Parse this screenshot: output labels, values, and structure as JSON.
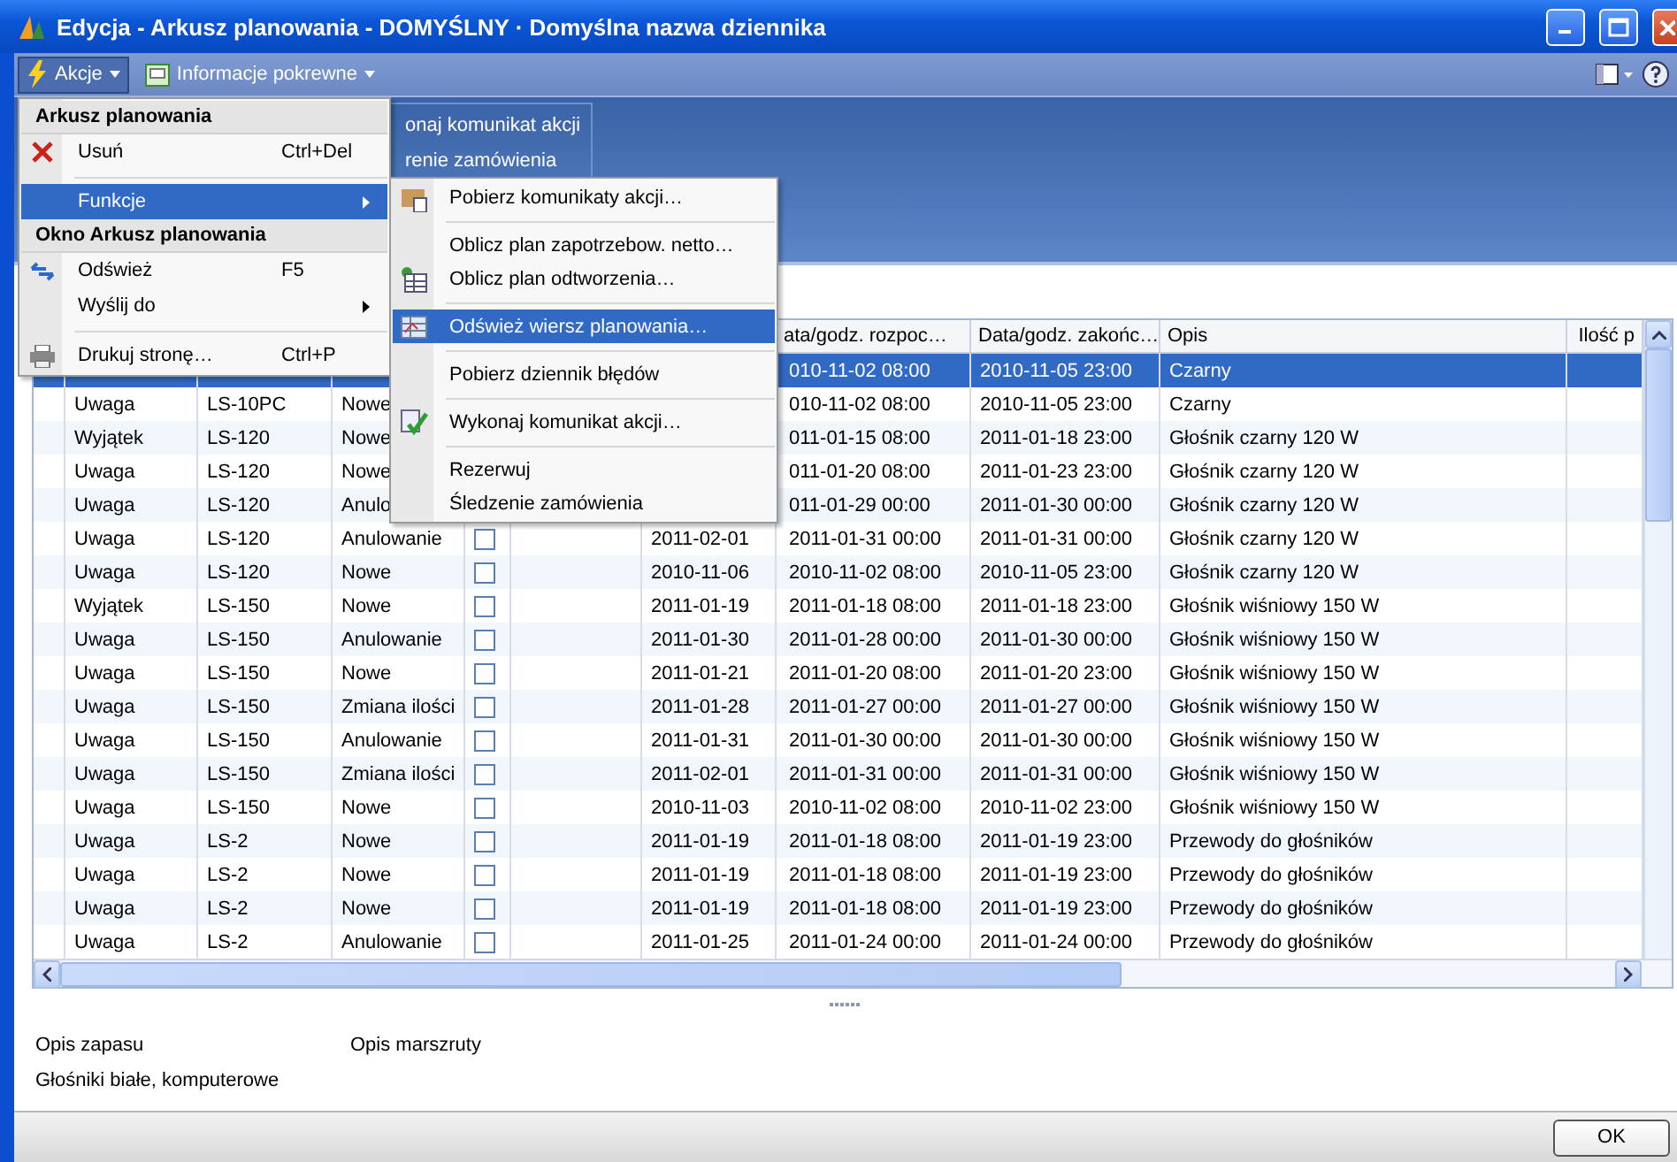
{
  "window": {
    "title": "Edycja - Arkusz planowania - DOMYŚLNY · Domyślna nazwa dziennika"
  },
  "toolbar": {
    "items": [
      {
        "label": "Akcje",
        "pressed": true
      },
      {
        "label": "Informacje pokrewne",
        "pressed": false
      }
    ]
  },
  "ribbon": {
    "items": [
      "onaj komunikat akcji",
      "renie zamówienia"
    ]
  },
  "table": {
    "columns": [
      null,
      null,
      null,
      null,
      null,
      null,
      null,
      "ata/godz. rozpoc…",
      "Data/godz. zakońc…",
      "Opis",
      "Ilość p"
    ],
    "rows": [
      {
        "selected": true,
        "cells": [
          null,
          null,
          null,
          null,
          "010-11-02 08:00",
          "2010-11-05 23:00",
          "Czarny"
        ]
      },
      {
        "selected": false,
        "cells": [
          "Uwaga",
          "LS-10PC",
          "Nowe",
          null,
          "010-11-02 08:00",
          "2010-11-05 23:00",
          "Czarny"
        ]
      },
      {
        "selected": false,
        "cells": [
          "Wyjątek",
          "LS-120",
          "Nowe",
          null,
          "011-01-15 08:00",
          "2011-01-18 23:00",
          "Głośnik czarny 120 W"
        ]
      },
      {
        "selected": false,
        "cells": [
          "Uwaga",
          "LS-120",
          "Nowe",
          null,
          "011-01-20 08:00",
          "2011-01-23 23:00",
          "Głośnik czarny 120 W"
        ]
      },
      {
        "selected": false,
        "cells": [
          "Uwaga",
          "LS-120",
          "Anulo",
          null,
          "011-01-29 00:00",
          "2011-01-30 00:00",
          "Głośnik czarny 120 W"
        ]
      },
      {
        "selected": false,
        "checked": false,
        "cells": [
          "Uwaga",
          "LS-120",
          "Anulowanie",
          "2011-02-01",
          "2011-01-31 00:00",
          "2011-01-31 00:00",
          "Głośnik czarny 120 W"
        ]
      },
      {
        "selected": false,
        "checked": false,
        "cells": [
          "Uwaga",
          "LS-120",
          "Nowe",
          "2010-11-06",
          "2010-11-02 08:00",
          "2010-11-05 23:00",
          "Głośnik czarny 120 W"
        ]
      },
      {
        "selected": false,
        "checked": false,
        "cells": [
          "Wyjątek",
          "LS-150",
          "Nowe",
          "2011-01-19",
          "2011-01-18 08:00",
          "2011-01-18 23:00",
          "Głośnik wiśniowy 150 W"
        ]
      },
      {
        "selected": false,
        "checked": false,
        "cells": [
          "Uwaga",
          "LS-150",
          "Anulowanie",
          "2011-01-30",
          "2011-01-28 00:00",
          "2011-01-30 00:00",
          "Głośnik wiśniowy 150 W"
        ]
      },
      {
        "selected": false,
        "checked": false,
        "cells": [
          "Uwaga",
          "LS-150",
          "Nowe",
          "2011-01-21",
          "2011-01-20 08:00",
          "2011-01-20 23:00",
          "Głośnik wiśniowy 150 W"
        ]
      },
      {
        "selected": false,
        "checked": false,
        "cells": [
          "Uwaga",
          "LS-150",
          "Zmiana ilości",
          "2011-01-28",
          "2011-01-27 00:00",
          "2011-01-27 00:00",
          "Głośnik wiśniowy 150 W"
        ]
      },
      {
        "selected": false,
        "checked": false,
        "cells": [
          "Uwaga",
          "LS-150",
          "Anulowanie",
          "2011-01-31",
          "2011-01-30 00:00",
          "2011-01-30 00:00",
          "Głośnik wiśniowy 150 W"
        ]
      },
      {
        "selected": false,
        "checked": false,
        "cells": [
          "Uwaga",
          "LS-150",
          "Zmiana ilości",
          "2011-02-01",
          "2011-01-31 00:00",
          "2011-01-31 00:00",
          "Głośnik wiśniowy 150 W"
        ]
      },
      {
        "selected": false,
        "checked": false,
        "cells": [
          "Uwaga",
          "LS-150",
          "Nowe",
          "2010-11-03",
          "2010-11-02 08:00",
          "2010-11-02 23:00",
          "Głośnik wiśniowy 150 W"
        ]
      },
      {
        "selected": false,
        "checked": false,
        "cells": [
          "Uwaga",
          "LS-2",
          "Nowe",
          "2011-01-19",
          "2011-01-18 08:00",
          "2011-01-19 23:00",
          "Przewody do głośników"
        ]
      },
      {
        "selected": false,
        "checked": false,
        "cells": [
          "Uwaga",
          "LS-2",
          "Nowe",
          "2011-01-19",
          "2011-01-18 08:00",
          "2011-01-19 23:00",
          "Przewody do głośników"
        ]
      },
      {
        "selected": false,
        "checked": false,
        "cells": [
          "Uwaga",
          "LS-2",
          "Nowe",
          "2011-01-19",
          "2011-01-18 08:00",
          "2011-01-19 23:00",
          "Przewody do głośników"
        ]
      },
      {
        "selected": false,
        "checked": false,
        "cells": [
          "Uwaga",
          "LS-2",
          "Anulowanie",
          "2011-01-25",
          "2011-01-24 00:00",
          "2011-01-24 00:00",
          "Przewody do głośników"
        ]
      }
    ]
  },
  "menu": {
    "items": [
      {
        "kind": "header",
        "label": "Arkusz planowania"
      },
      {
        "kind": "item",
        "label": "Usuń",
        "shortcut": "Ctrl+Del",
        "selected": false
      },
      {
        "kind": "separator"
      },
      {
        "kind": "submenu",
        "label": "Funkcje",
        "selected": true
      },
      {
        "kind": "header",
        "label": "Okno Arkusz planowania"
      },
      {
        "kind": "item",
        "label": "Odśwież",
        "shortcut": "F5",
        "selected": false
      },
      {
        "kind": "submenu",
        "label": "Wyślij do",
        "selected": false
      },
      {
        "kind": "separator"
      },
      {
        "kind": "item",
        "label": "Drukuj stronę…",
        "shortcut": "Ctrl+P",
        "selected": false
      }
    ]
  },
  "submenu": {
    "items": [
      {
        "kind": "item",
        "label": "Pobierz komunikaty akcji…",
        "selected": false
      },
      {
        "kind": "separator"
      },
      {
        "kind": "item",
        "label": "Oblicz plan zapotrzebow. netto…",
        "selected": false
      },
      {
        "kind": "item",
        "label": "Oblicz plan odtworzenia…",
        "selected": false
      },
      {
        "kind": "separator"
      },
      {
        "kind": "item",
        "label": "Odśwież wiersz planowania…",
        "selected": true
      },
      {
        "kind": "separator"
      },
      {
        "kind": "item",
        "label": "Pobierz dziennik błędów",
        "selected": false
      },
      {
        "kind": "separator"
      },
      {
        "kind": "item",
        "label": "Wykonaj komunikat akcji…",
        "selected": false
      },
      {
        "kind": "separator"
      },
      {
        "kind": "item",
        "label": "Rezerwuj",
        "selected": false
      },
      {
        "kind": "item",
        "label": "Śledzenie zamówienia",
        "selected": false
      }
    ]
  },
  "details": {
    "labels": [
      "Opis zapasu",
      "Opis marszruty"
    ],
    "value": "Głośniki białe, komputerowe"
  },
  "buttons": [
    "OK"
  ]
}
